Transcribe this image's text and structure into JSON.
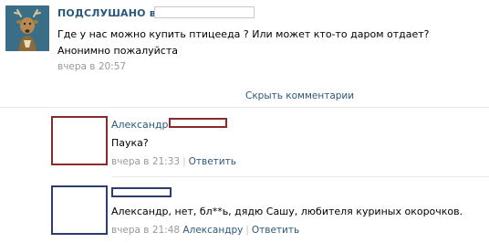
{
  "post": {
    "author": "ПОДСЛУШАНО в",
    "text_line1": "Где у нас можно купить птицееда ? Или может кто-то даром отдает?",
    "text_line2": "Анонимно пожалуйста",
    "date": "вчера в 20:57"
  },
  "comments_toggle": "Скрыть комментарии",
  "comments": [
    {
      "author": "Александр",
      "text": "Паука?",
      "date": "вчера в 21:33",
      "separator": "|",
      "reply_label": "Ответить"
    },
    {
      "author": "",
      "text": "Александр, нет, бл**ь, дядю Сашу, любителя куриных окорочков.",
      "date": "вчера в 21:48",
      "reply_to": "Александру",
      "separator": "|",
      "reply_label": "Ответить"
    }
  ],
  "colors": {
    "link": "#2b587a",
    "meta": "#999999",
    "comment1_redact_border": "#8b2a2a",
    "comment2_redact_border": "#2f3c6e"
  }
}
